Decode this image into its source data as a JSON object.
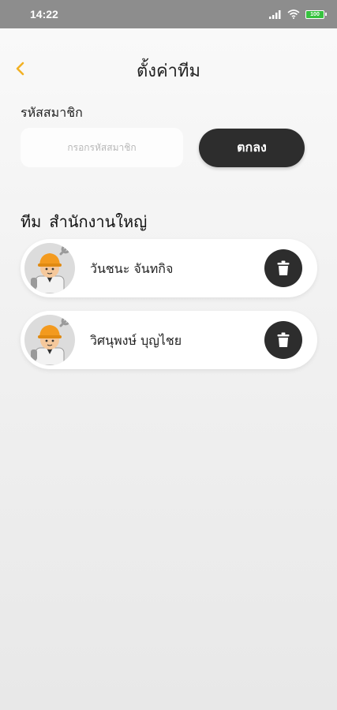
{
  "status_bar": {
    "time": "14:22",
    "battery": "100"
  },
  "header": {
    "title": "ตั้งค่าทีม"
  },
  "member_code": {
    "label": "รหัสสมาชิก",
    "placeholder": "กรอกรหัสสมาชิก",
    "value": "",
    "submit_label": "ตกลง"
  },
  "team": {
    "prefix": "ทีม",
    "name": "สำนักงานใหญ่",
    "members": [
      {
        "name": "วันชนะ จันทกิจ"
      },
      {
        "name": "วิศนุพงษ์ บุญไชย"
      }
    ]
  },
  "colors": {
    "accent": "#f2b124",
    "dark": "#2d2d2d"
  }
}
